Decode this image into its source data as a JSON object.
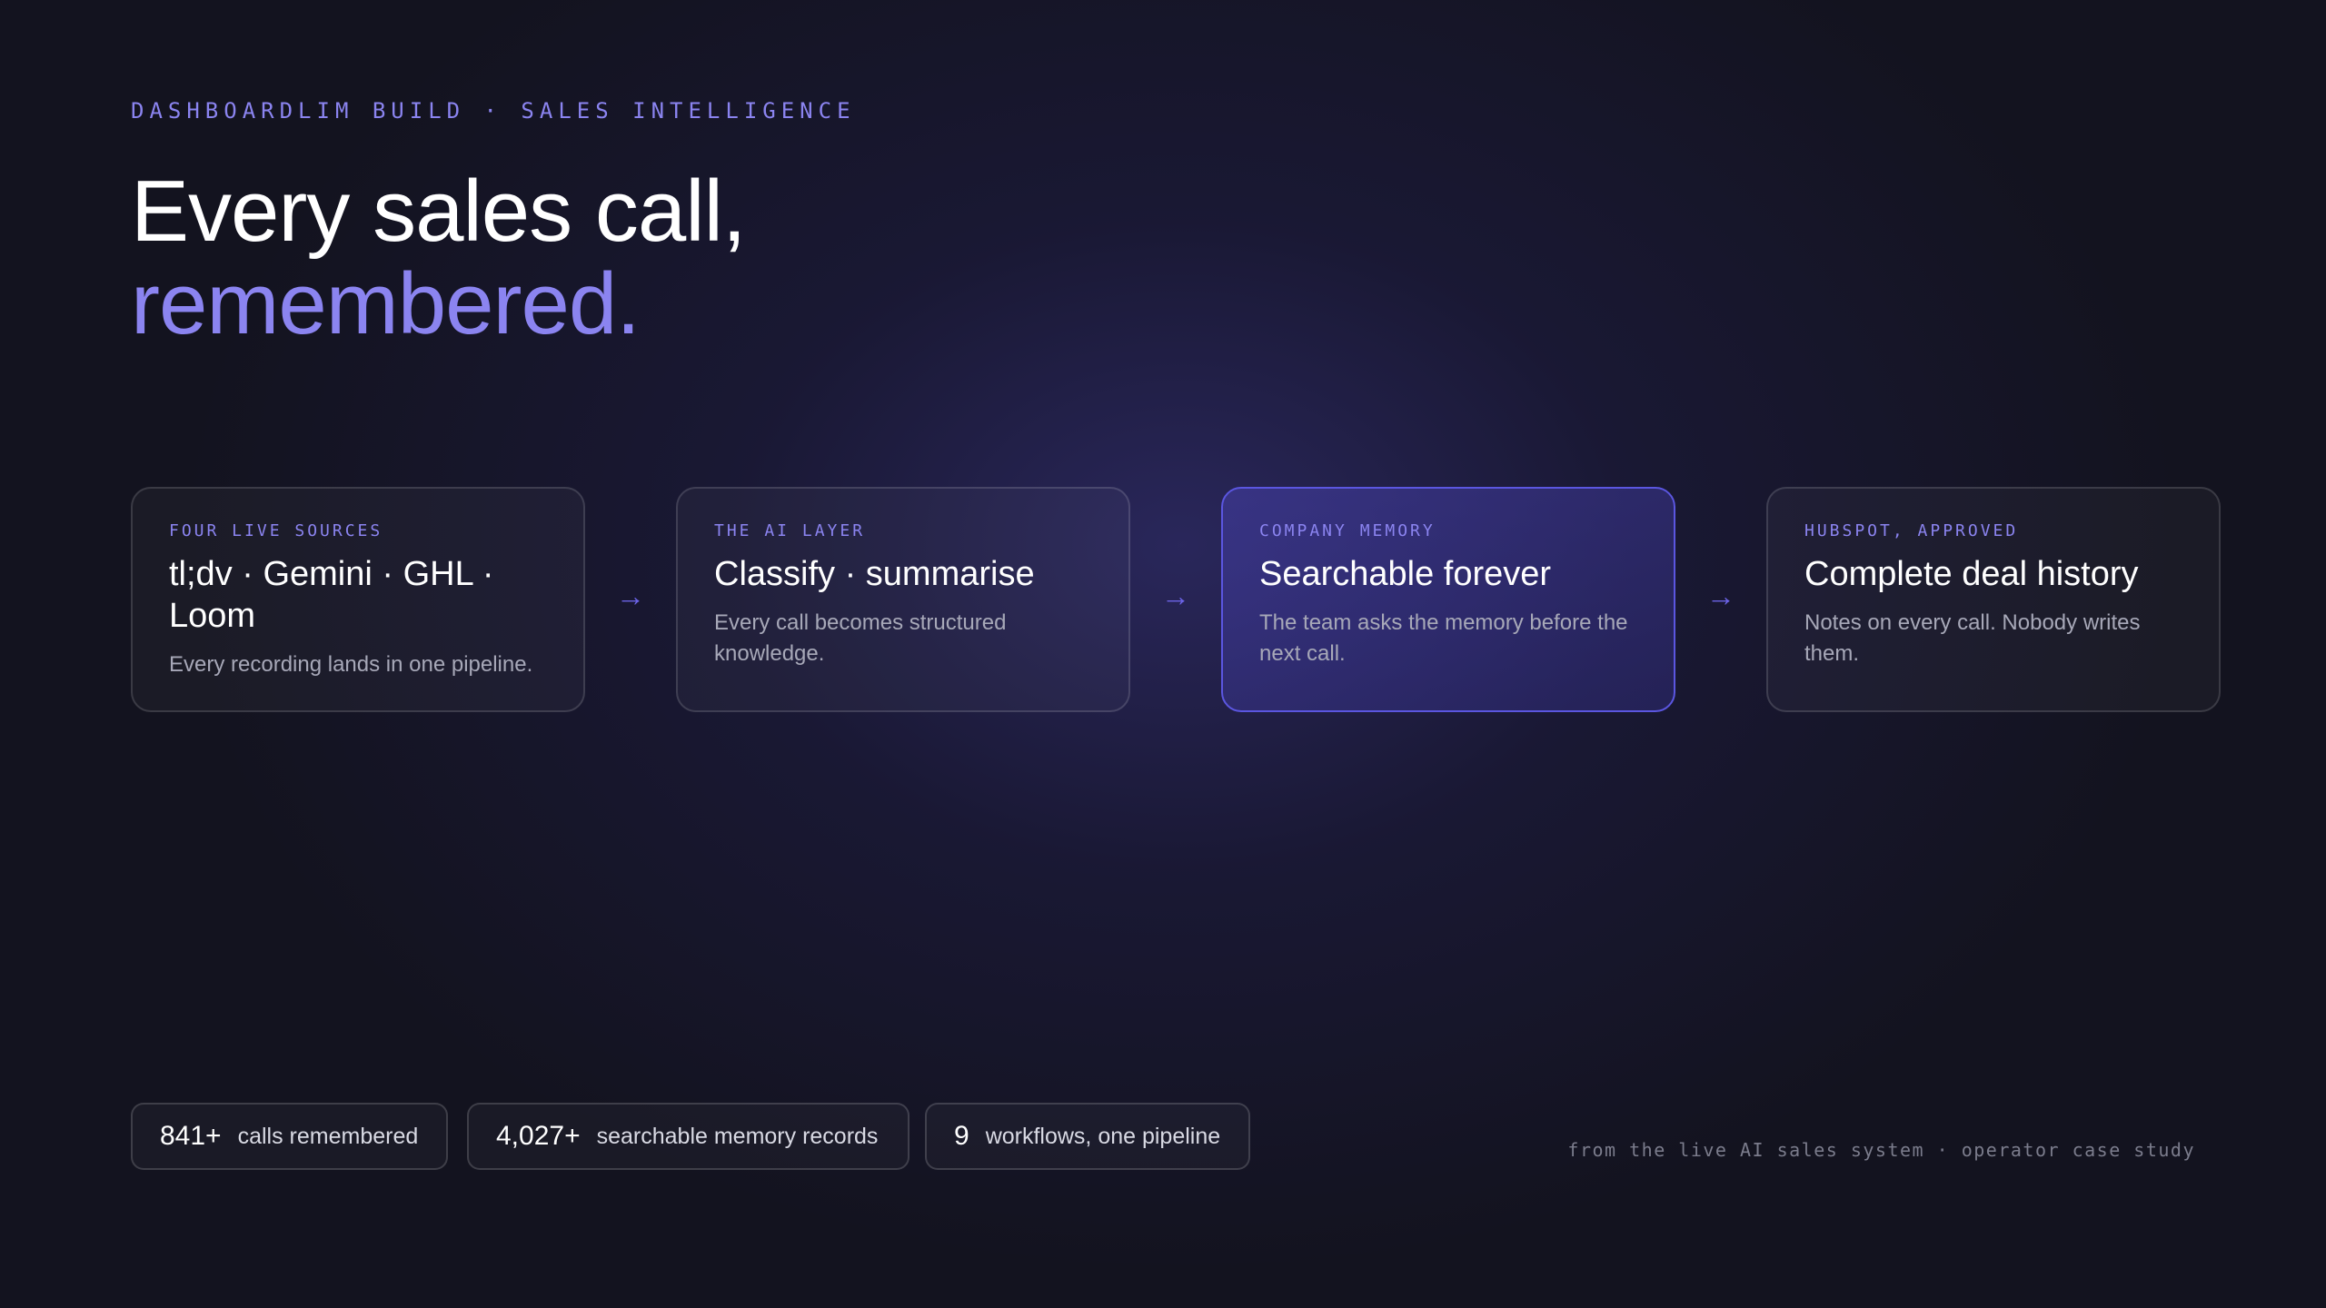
{
  "eyebrow": "DASHBOARDLIM BUILD · SALES INTELLIGENCE",
  "headline": {
    "line1": "Every sales call,",
    "line2": "remembered."
  },
  "pipeline": {
    "cards": [
      {
        "eyebrow": "FOUR LIVE SOURCES",
        "title": "tl;dv · Gemini · GHL · Loom",
        "description": "Every recording lands in one pipeline."
      },
      {
        "eyebrow": "THE AI LAYER",
        "title": "Classify · summarise",
        "description": "Every call becomes structured knowledge."
      },
      {
        "eyebrow": "COMPANY MEMORY",
        "title": "Searchable forever",
        "description": "The team asks the memory before the next call."
      },
      {
        "eyebrow": "HUBSPOT, APPROVED",
        "title": "Complete deal history",
        "description": "Notes on every call. Nobody writes them."
      }
    ],
    "arrow": "→"
  },
  "stats": [
    {
      "value": "841+",
      "label": "calls remembered"
    },
    {
      "value": "4,027+",
      "label": "searchable memory records"
    },
    {
      "value": "9",
      "label": "workflows, one pipeline"
    }
  ],
  "footer_note": "from the live AI sales system · operator case study",
  "colors": {
    "background": "#13131f",
    "accent": "#8b84f0",
    "active_border": "#5b56e0",
    "arrow": "#6b63e6"
  }
}
